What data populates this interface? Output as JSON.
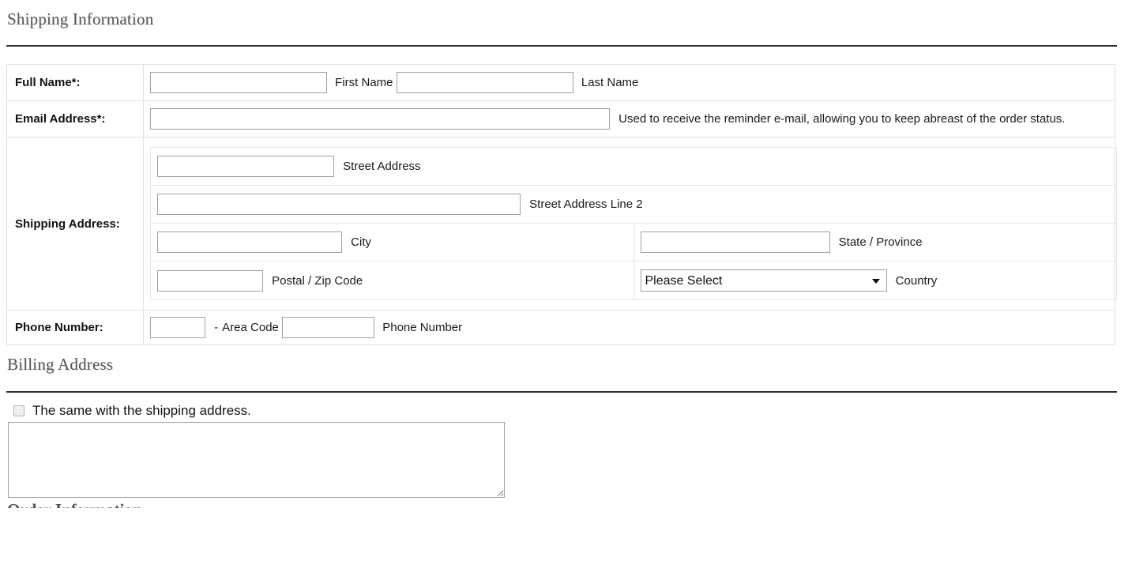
{
  "shipping": {
    "heading": "Shipping Information",
    "rows": {
      "full_name": {
        "label": "Full Name*:",
        "first": {
          "value": "",
          "placeholder": "",
          "hint": "First Name"
        },
        "last": {
          "value": "",
          "placeholder": "",
          "hint": "Last Name"
        }
      },
      "email": {
        "label": "Email Address*:",
        "field": {
          "value": "",
          "placeholder": ""
        },
        "hint": "Used to receive the reminder e-mail, allowing you to keep abreast of the order status."
      },
      "address": {
        "label": "Shipping Address:",
        "street": {
          "value": "",
          "placeholder": "",
          "hint": "Street Address"
        },
        "street2": {
          "value": "",
          "placeholder": "",
          "hint": "Street Address Line 2"
        },
        "city": {
          "value": "",
          "placeholder": "",
          "hint": "City"
        },
        "state": {
          "value": "",
          "placeholder": "",
          "hint": "State / Province"
        },
        "zip": {
          "value": "",
          "placeholder": "",
          "hint": "Postal / Zip Code"
        },
        "country": {
          "selected": "Please Select",
          "hint": "Country",
          "options": [
            "Please Select"
          ]
        }
      },
      "phone": {
        "label": "Phone Number:",
        "area": {
          "value": "",
          "placeholder": ""
        },
        "dash": "-",
        "area_hint": "Area Code",
        "number": {
          "value": "",
          "placeholder": ""
        },
        "number_hint": "Phone Number"
      }
    }
  },
  "billing": {
    "heading": "Billing Address",
    "same_as_shipping": {
      "label": "The same with the shipping address.",
      "checked": false
    },
    "address_text": {
      "value": "",
      "placeholder": ""
    }
  },
  "next_section": {
    "heading": "Order Information"
  },
  "colors": {
    "rule": "#2f2f2f",
    "heading_text": "#555555",
    "border_outer": "#e0e0e0",
    "border_inner": "#e6e6e6",
    "input_border": "#a0a0a0",
    "text": "#1a1a1a"
  }
}
